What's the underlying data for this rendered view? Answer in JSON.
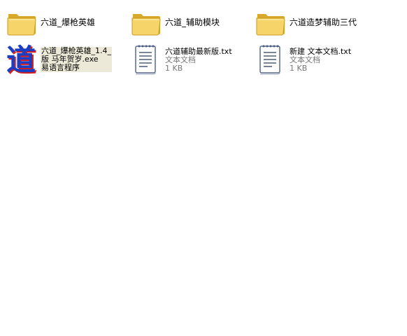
{
  "items": [
    {
      "type": "folder",
      "name": "六道_爆枪英雄",
      "icon": "folder-icon"
    },
    {
      "type": "folder",
      "name": "六道_辅助模块",
      "icon": "folder-icon"
    },
    {
      "type": "folder",
      "name": "六道造梦辅助三代",
      "icon": "folder-icon"
    },
    {
      "type": "exe",
      "name_lines": [
        "六道_爆枪英雄_1.4_",
        "版   马年贺岁.exe",
        "易语言程序"
      ],
      "icon": "dao-app-icon"
    },
    {
      "type": "txt",
      "name": "六道辅助最新版.txt",
      "kind": "文本文档",
      "size": "1 KB",
      "icon": "text-document-icon"
    },
    {
      "type": "txt",
      "name": "新建 文本文档.txt",
      "kind": "文本文档",
      "size": "1 KB",
      "icon": "text-document-icon"
    }
  ],
  "colors": {
    "folder_body": "#f6d46a",
    "folder_dark": "#d9a92b",
    "exe_blue": "#1b3fc4",
    "exe_red": "#d21e1e",
    "meta_text": "#777777"
  }
}
